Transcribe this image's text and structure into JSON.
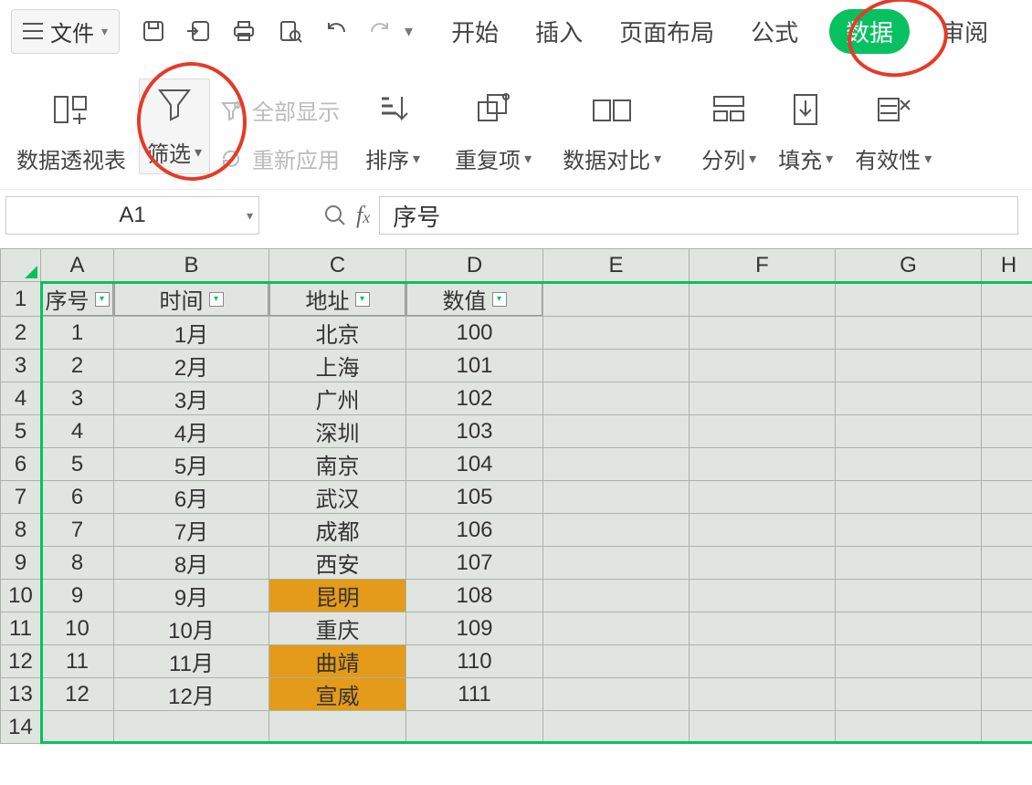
{
  "titlebar": {
    "file_label": "文件",
    "tabs": [
      "开始",
      "插入",
      "页面布局",
      "公式",
      "数据",
      "审阅"
    ],
    "active_tab_index": 4
  },
  "ribbon": {
    "pivot": "数据透视表",
    "filter": "筛选",
    "show_all": "全部显示",
    "reapply": "重新应用",
    "sort": "排序",
    "dedup": "重复项",
    "compare": "数据对比",
    "split": "分列",
    "fill": "填充",
    "validity": "有效性"
  },
  "formula_bar": {
    "namebox": "A1",
    "formula": "序号"
  },
  "columns": [
    "A",
    "B",
    "C",
    "D",
    "E",
    "F",
    "G",
    "H"
  ],
  "headers": {
    "A": "序号",
    "B": "时间",
    "C": "地址",
    "D": "数值"
  },
  "rows": [
    {
      "n": 1,
      "A": "1",
      "B": "1月",
      "C": "北京",
      "D": "100"
    },
    {
      "n": 2,
      "A": "2",
      "B": "2月",
      "C": "上海",
      "D": "101"
    },
    {
      "n": 3,
      "A": "3",
      "B": "3月",
      "C": "广州",
      "D": "102"
    },
    {
      "n": 4,
      "A": "4",
      "B": "4月",
      "C": "深圳",
      "D": "103"
    },
    {
      "n": 5,
      "A": "5",
      "B": "5月",
      "C": "南京",
      "D": "104"
    },
    {
      "n": 6,
      "A": "6",
      "B": "6月",
      "C": "武汉",
      "D": "105"
    },
    {
      "n": 7,
      "A": "7",
      "B": "7月",
      "C": "成都",
      "D": "106"
    },
    {
      "n": 8,
      "A": "8",
      "B": "8月",
      "C": "西安",
      "D": "107"
    },
    {
      "n": 9,
      "A": "9",
      "B": "9月",
      "C": "昆明",
      "D": "108",
      "hl": true
    },
    {
      "n": 10,
      "A": "10",
      "B": "10月",
      "C": "重庆",
      "D": "109"
    },
    {
      "n": 11,
      "A": "11",
      "B": "11月",
      "C": "曲靖",
      "D": "110",
      "hl": true
    },
    {
      "n": 12,
      "A": "12",
      "B": "12月",
      "C": "宣威",
      "D": "111",
      "hl": true
    }
  ],
  "blank_rows": [
    14
  ]
}
